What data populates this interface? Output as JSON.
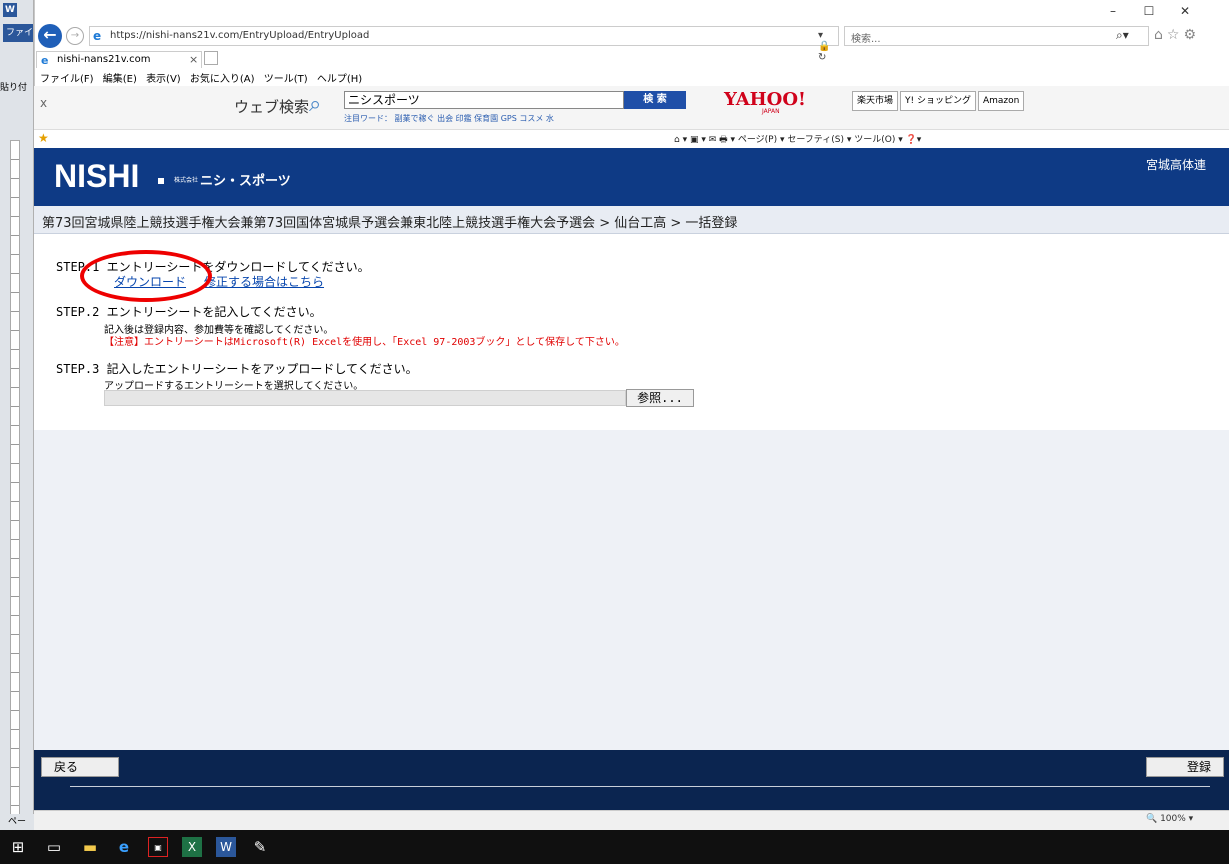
{
  "word": {
    "tab_label": "ファイ",
    "logo": "W",
    "paste_label": "貼り付",
    "status_label": "ペー"
  },
  "browser": {
    "url": "https://nishi-nans21v.com/EntryUpload/EntryUpload",
    "address_controls": "▾ 🔒 ↻",
    "search_placeholder": "検索...",
    "tab_title": "nishi-nans21v.com",
    "menu": [
      "ファイル(F)",
      "編集(E)",
      "表示(V)",
      "お気に入り(A)",
      "ツール(T)",
      "ヘルプ(H)"
    ],
    "command_bar": "⌂ ▾  ▣ ▾  ✉  🖶 ▾  ページ(P) ▾  セーフティ(S) ▾  ツール(O) ▾  ❓▾",
    "zoom": "🔍 100%  ▾"
  },
  "yahoo_toolbar": {
    "search_label": "ウェブ検索",
    "search_value": "ニシスポーツ",
    "search_button": "検 索",
    "hot_words": "注目ワード： 副業で稼ぐ  出会  印鑑  保育園  GPS  コスメ  水",
    "logo": "YAHOO!",
    "logo_sub": "JAPAN",
    "links": [
      "楽天市場",
      "Y! ショッピング",
      "Amazon"
    ]
  },
  "header": {
    "logo": "NISHI",
    "corp_small": "株式会社",
    "corp_name": "ニシ・スポーツ",
    "user": "宮城高体連"
  },
  "breadcrumb": "第73回宮城県陸上競技選手権大会兼第73回国体宮城県予選会兼東北陸上競技選手権大会予選会 > 仙台工高 > 一括登録",
  "steps": {
    "step1_title": "STEP.1 エントリーシートをダウンロードしてください。",
    "download_link": "ダウンロード",
    "fix_link": "修正する場合はこちら",
    "step2_title": "STEP.2 エントリーシートを記入してください。",
    "step2_note": "記入後は登録内容、参加費等を確認してください。",
    "step2_warning": "【注意】エントリーシートはMicrosoft(R) Excelを使用し、「Excel 97-2003ブック」として保存して下さい。",
    "step3_title": "STEP.3 記入したエントリーシートをアップロードしてください。",
    "step3_note": "アップロードするエントリーシートを選択してください。",
    "browse_button": "参照..."
  },
  "footer": {
    "back_button": "戻る",
    "register_button": "登録"
  },
  "colors": {
    "header_bg": "#0e3a85",
    "footer_bg": "#0b2550",
    "annotation_circle": "#e00000"
  }
}
